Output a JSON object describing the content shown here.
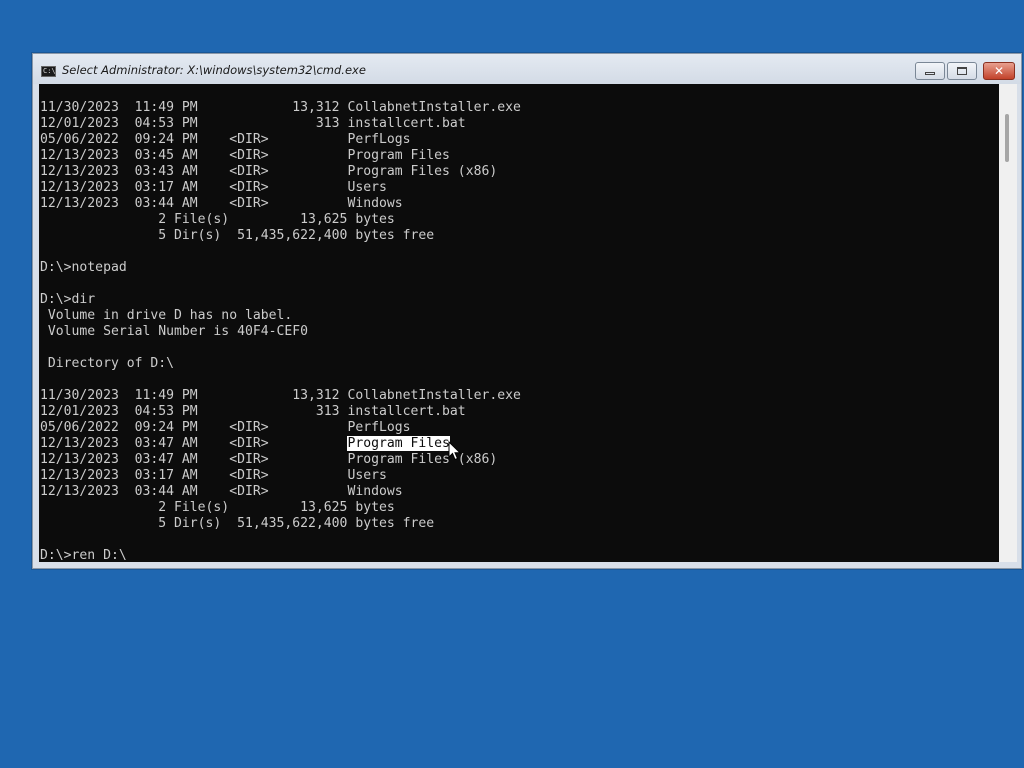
{
  "window": {
    "title": "Select Administrator: X:\\windows\\system32\\cmd.exe",
    "icon_text": "C:\\."
  },
  "buttons": {
    "close": "✕"
  },
  "console": {
    "before_selection": "11/30/2023  11:49 PM            13,312 CollabnetInstaller.exe\n12/01/2023  04:53 PM               313 installcert.bat\n05/06/2022  09:24 PM    <DIR>          PerfLogs\n12/13/2023  03:45 AM    <DIR>          Program Files\n12/13/2023  03:43 AM    <DIR>          Program Files (x86)\n12/13/2023  03:17 AM    <DIR>          Users\n12/13/2023  03:44 AM    <DIR>          Windows\n               2 File(s)         13,625 bytes\n               5 Dir(s)  51,435,622,400 bytes free\n\nD:\\>notepad\n\nD:\\>dir\n Volume in drive D has no label.\n Volume Serial Number is 40F4-CEF0\n\n Directory of D:\\\n\n11/30/2023  11:49 PM            13,312 CollabnetInstaller.exe\n12/01/2023  04:53 PM               313 installcert.bat\n05/06/2022  09:24 PM    <DIR>          PerfLogs\n12/13/2023  03:47 AM    <DIR>          ",
    "selection": "Program Files",
    "after_selection": "\n12/13/2023  03:47 AM    <DIR>          Program Files (x86)\n12/13/2023  03:17 AM    <DIR>          Users\n12/13/2023  03:44 AM    <DIR>          Windows\n               2 File(s)         13,625 bytes\n               5 Dir(s)  51,435,622,400 bytes free\n\nD:\\>ren D:\\"
  },
  "colors": {
    "desktop": "#1f67b1",
    "console_bg": "#0c0c0c",
    "console_fg": "#cccccc",
    "selection_bg": "#ffffff"
  }
}
